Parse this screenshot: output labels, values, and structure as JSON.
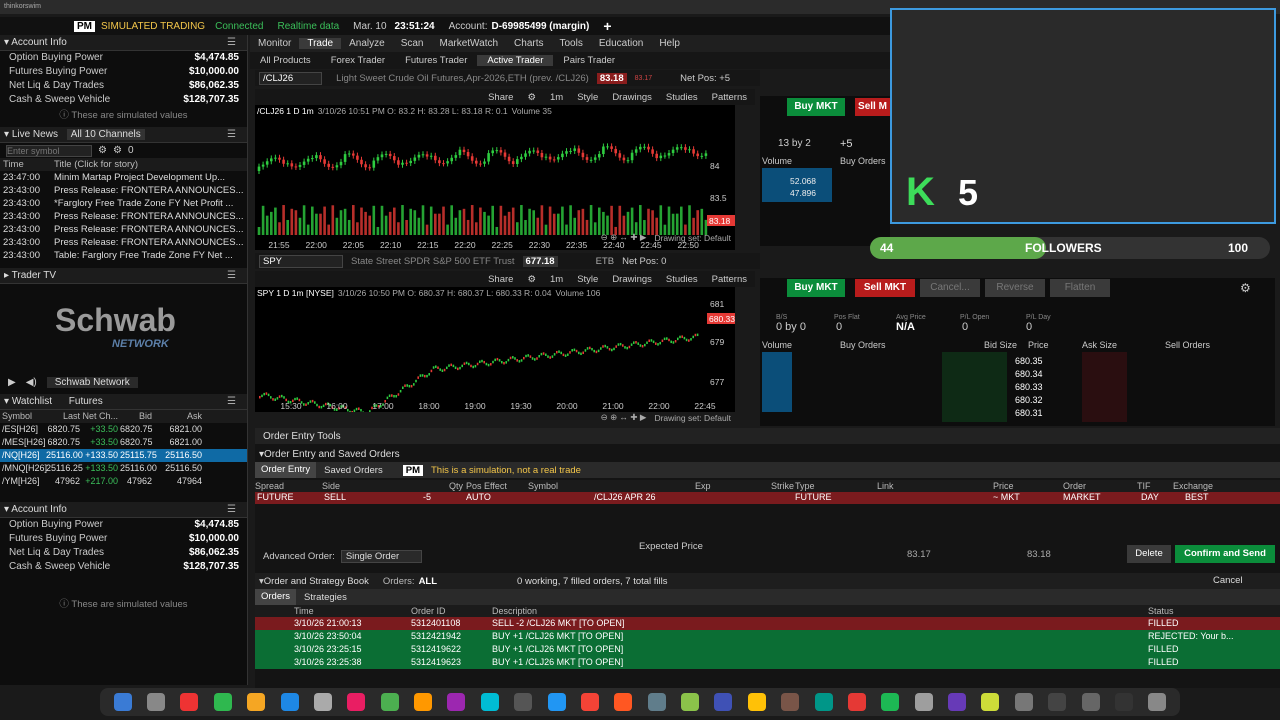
{
  "topbar": {
    "title": "thinkorswim"
  },
  "status": {
    "pm": "PM",
    "mode": "SIMULATED TRADING",
    "conn": "Connected",
    "rt": "Realtime data",
    "date": "Mar. 10",
    "time": "23:51:24",
    "acct_label": "Account:",
    "acct": "D-69985499 (margin)",
    "plus": "+"
  },
  "account": {
    "title": "Account Info",
    "rows": [
      {
        "k": "Option Buying Power",
        "v": "$4,474.85"
      },
      {
        "k": "Futures Buying Power",
        "v": "$10,000.00"
      },
      {
        "k": "Net Liq & Day Trades",
        "v": "$86,062.35"
      },
      {
        "k": "Cash & Sweep Vehicle",
        "v": "$128,707.35"
      }
    ],
    "sim": "These are simulated values"
  },
  "news": {
    "title": "Live News",
    "channels": "All 10 Channels",
    "placeholder": "Enter symbol",
    "count": "0",
    "h_time": "Time",
    "h_title": "Title (Click for story)",
    "rows": [
      {
        "t": "23:47:00",
        "s": "Minim Martap Project Development Up..."
      },
      {
        "t": "23:43:00",
        "s": "Press Release: FRONTERA ANNOUNCES..."
      },
      {
        "t": "23:43:00",
        "s": "*Farglory Free Trade Zone FY Net Profit ..."
      },
      {
        "t": "23:43:00",
        "s": "Press Release: FRONTERA ANNOUNCES..."
      },
      {
        "t": "23:43:00",
        "s": "Press Release: FRONTERA ANNOUNCES..."
      },
      {
        "t": "23:43:00",
        "s": "Press Release: FRONTERA ANNOUNCES..."
      },
      {
        "t": "23:43:00",
        "s": "Table: Farglory Free Trade Zone FY Net ..."
      }
    ]
  },
  "tv": {
    "title": "Trader TV",
    "logo": "Schwab",
    "logo2": "NETWORK",
    "channel": "Schwab Network"
  },
  "watchlist": {
    "title": "Watchlist",
    "list": "Futures",
    "h": [
      "Symbol",
      "Last",
      "Net Ch...",
      "Bid",
      "Ask"
    ],
    "rows": [
      {
        "s": "/ES[H26]",
        "l": "6820.75",
        "n": "+33.50",
        "b": "6820.75",
        "a": "6821.00"
      },
      {
        "s": "/MES[H26]",
        "l": "6820.75",
        "n": "+33.50",
        "b": "6820.75",
        "a": "6821.00"
      },
      {
        "s": "/NQ[H26]",
        "l": "25116.00",
        "n": "+133.50",
        "b": "25115.75",
        "a": "25116.50"
      },
      {
        "s": "/MNQ[H26]",
        "l": "25116.25",
        "n": "+133.50",
        "b": "25116.00",
        "a": "25116.50"
      },
      {
        "s": "/YM[H26]",
        "l": "47962",
        "n": "+217.00",
        "b": "47962",
        "a": "47964"
      }
    ]
  },
  "menu": [
    "Monitor",
    "Trade",
    "Analyze",
    "Scan",
    "MarketWatch",
    "Charts",
    "Tools",
    "Education",
    "Help"
  ],
  "submenu": [
    "All Products",
    "Forex Trader",
    "Futures Trader",
    "Active Trader",
    "Pairs Trader"
  ],
  "c1": {
    "sym": "/CLJ26",
    "desc": "Light Sweet Crude Oil Futures,Apr-2026,ETH (prev. /CLJ26)",
    "price": "83.18",
    "chg": "83.17",
    "netpos": "Net Pos: +5",
    "tf": "/CLJ26 1 D 1m",
    "info": "3/10/26 10:51 PM  O: 83.2  H: 83.28  L: 83.18  R: 0.1",
    "vol": "Volume 35",
    "share": "Share",
    "int": "1m",
    "style": "Style",
    "draw": "Drawings",
    "stud": "Studies",
    "pat": "Patterns",
    "last": "83.18",
    "times": [
      "21:55",
      "22:00",
      "22:05",
      "22:10",
      "22:15",
      "22:20",
      "22:25",
      "22:30",
      "22:35",
      "22:40",
      "22:45",
      "22:50"
    ],
    "ylabels": [
      "84",
      "83.5"
    ],
    "dset": "Drawing set: Default"
  },
  "c2": {
    "sym": "SPY",
    "desc": "State Street SPDR S&P 500 ETF Trust",
    "price": "677.18",
    "etb": "ETB",
    "netpos": "Net Pos: 0",
    "tf": "SPY 1 D 1m [NYSE]",
    "info": "3/10/26 10:50 PM  O: 680.37  H: 680.37  L: 680.33  R: 0.04",
    "vol": "Volume 106",
    "last": "680.33",
    "times": [
      "15:30",
      "16:00",
      "17:00",
      "18:00",
      "19:00",
      "19:30",
      "20:00",
      "21:00",
      "22:00",
      "22:45"
    ],
    "ylabels": [
      "681",
      "679",
      "677"
    ],
    "dset": "Drawing set: Default"
  },
  "at1": {
    "buy": "Buy MKT",
    "sell": "Sell M",
    "bs": "13 by 2",
    "pos": "+5",
    "vol": "Volume",
    "bo": "Buy Orders",
    "v1": "52.068",
    "v2": "47.896"
  },
  "at2": {
    "buy": "Buy MKT",
    "sell": "Sell MKT",
    "cancel": "Cancel...",
    "reverse": "Reverse",
    "flatten": "Flatten",
    "bs": "0 by 0",
    "posflat": "0",
    "avg": "N/A",
    "plopen": "0",
    "plday": "0",
    "h": [
      "Volume",
      "Buy Orders",
      "Bid Size",
      "Price",
      "Ask Size",
      "Sell Orders"
    ],
    "prices": [
      "680.35",
      "680.34",
      "680.33",
      "680.32",
      "680.31"
    ],
    "lbl_bs": "B/S",
    "lbl_pf": "Pos Flat",
    "lbl_ap": "Avg Price",
    "lbl_po": "P/L Open",
    "lbl_pd": "P/L Day"
  },
  "cam": {
    "k": "5",
    "followers": "FOLLOWERS",
    "n1": "44",
    "n2": "100"
  },
  "oe": {
    "tools": "Order Entry Tools",
    "saved": "Order Entry and Saved Orders",
    "tab1": "Order Entry",
    "tab2": "Saved Orders",
    "pm": "PM",
    "simnote": "This is a simulation, not a real trade",
    "h": [
      "Spread",
      "Side",
      "Qty",
      "Pos Effect",
      "Symbol",
      "Exp",
      "Strike",
      "Type",
      "Link",
      "Price",
      "Order",
      "TIF",
      "Exchange"
    ],
    "row": {
      "spread": "FUTURE",
      "side": "SELL",
      "qty": "-5",
      "pe": "AUTO",
      "sym": "/CLJ26  APR 26",
      "type": "FUTURE",
      "price": "~ MKT",
      "order": "MARKET",
      "tif": "DAY",
      "exch": "BEST"
    },
    "adv": "Advanced Order:",
    "advv": "Single Order",
    "exp": "Expected  Price",
    "nat": "83.17",
    "mid": "83.18",
    "del": "Delete",
    "confirm": "Confirm and Send"
  },
  "book": {
    "title": "Order and Strategy Book",
    "orders": "Orders:",
    "all": "ALL",
    "summary": "0 working, 7 filled orders, 7 total fills",
    "cancel": "Cancel",
    "tab1": "Orders",
    "tab2": "Strategies",
    "h": [
      "Time",
      "Order ID",
      "Description",
      "Status"
    ],
    "rows": [
      {
        "t": "3/10/26 21:00:13",
        "id": "5312401108",
        "d": "SELL -2 /CLJ26 MKT [TO OPEN]",
        "s": "FILLED"
      },
      {
        "t": "3/10/26 23:50:04",
        "id": "5312421942",
        "d": "BUY +1 /CLJ26 MKT [TO OPEN]",
        "s": "REJECTED: Your b..."
      },
      {
        "t": "3/10/26 23:25:15",
        "id": "5312419622",
        "d": "BUY +1 /CLJ26 MKT [TO OPEN]",
        "s": "FILLED"
      },
      {
        "t": "3/10/26 23:25:38",
        "id": "5312419623",
        "d": "BUY +1 /CLJ26 MKT [TO OPEN]",
        "s": "FILLED"
      }
    ]
  }
}
